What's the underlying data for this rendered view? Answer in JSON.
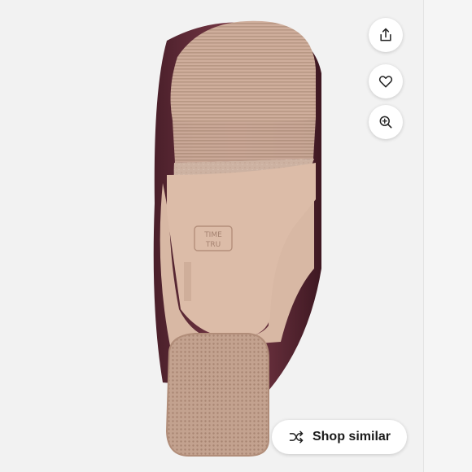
{
  "product": {
    "brand_stamp_line1": "TIME",
    "brand_stamp_line2": "TRU"
  },
  "actions": {
    "share_icon": "share-icon",
    "like_icon": "heart-icon",
    "zoom_icon": "zoom-in-icon"
  },
  "shop_similar": {
    "icon": "shuffle-icon",
    "label": "Shop similar"
  },
  "colors": {
    "leather": "#5a2a35",
    "sole": "#cfa995",
    "tread": "#c8aa97"
  }
}
